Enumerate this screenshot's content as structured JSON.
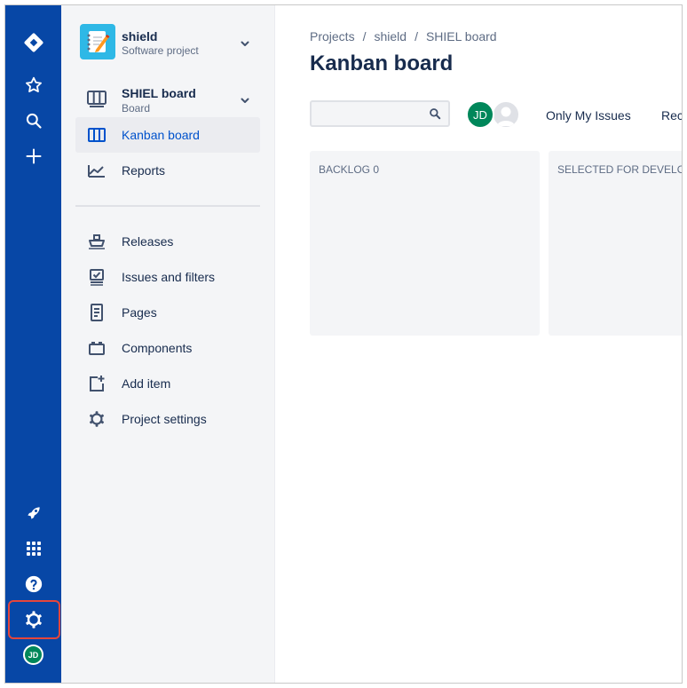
{
  "global_nav": {
    "icons": [
      "jira-logo-icon",
      "star-icon",
      "search-icon",
      "plus-icon",
      "rocket-icon",
      "app-switcher-icon",
      "help-icon",
      "gear-icon"
    ],
    "avatar_initials": "JD",
    "colors": {
      "background": "#0747a6",
      "highlight_border": "#e5463b",
      "avatar": "#00875a"
    }
  },
  "sidebar": {
    "project": {
      "name": "shield",
      "type": "Software project"
    },
    "board": {
      "name": "SHIEL board",
      "type": "Board"
    },
    "items": [
      {
        "label": "Kanban board",
        "icon": "kanban-board-icon",
        "active": true
      },
      {
        "label": "Reports",
        "icon": "reports-icon",
        "active": false
      },
      {
        "label": "Releases",
        "icon": "ship-icon",
        "active": false
      },
      {
        "label": "Issues and filters",
        "icon": "issues-icon",
        "active": false
      },
      {
        "label": "Pages",
        "icon": "page-icon",
        "active": false
      },
      {
        "label": "Components",
        "icon": "components-icon",
        "active": false
      },
      {
        "label": "Add item",
        "icon": "add-item-icon",
        "active": false
      },
      {
        "label": "Project settings",
        "icon": "gear-icon",
        "active": false
      }
    ],
    "colors": {
      "background": "#f4f5f7",
      "active_text": "#0052cc"
    }
  },
  "main": {
    "breadcrumbs": [
      "Projects",
      "shield",
      "SHIEL board"
    ],
    "breadcrumb_separator": "/",
    "title": "Kanban board",
    "search": {
      "value": "",
      "placeholder": ""
    },
    "avatar_initials": "JD",
    "quick_filters": [
      "Only My Issues",
      "Rec"
    ],
    "columns": [
      {
        "name": "BACKLOG",
        "count": "0"
      },
      {
        "name": "SELECTED FOR DEVELOP"
      }
    ]
  }
}
